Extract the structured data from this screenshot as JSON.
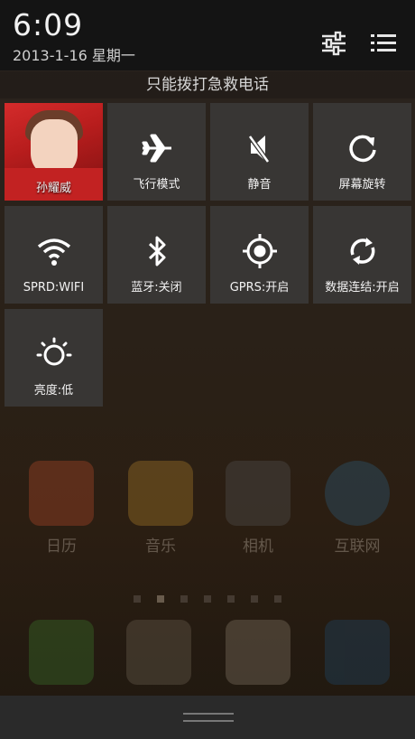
{
  "status": {
    "time": "6:09",
    "date": "2013-1-16 星期一"
  },
  "header_icons": {
    "settings": "sliders-icon",
    "list": "list-icon"
  },
  "notice": "只能拨打急救电话",
  "tiles": [
    {
      "label": "孙耀威",
      "icon": "avatar"
    },
    {
      "label": "飞行模式",
      "icon": "airplane-icon"
    },
    {
      "label": "静音",
      "icon": "mute-icon"
    },
    {
      "label": "屏幕旋转",
      "icon": "rotate-icon"
    },
    {
      "label": "SPRD:WIFI",
      "icon": "wifi-icon"
    },
    {
      "label": "蓝牙:关闭",
      "icon": "bluetooth-icon"
    },
    {
      "label": "GPRS:开启",
      "icon": "gps-icon"
    },
    {
      "label": "数据连结:开启",
      "icon": "sync-icon"
    },
    {
      "label": "亮度:低",
      "icon": "brightness-icon"
    }
  ],
  "home_apps": [
    {
      "label": "日历"
    },
    {
      "label": "音乐"
    },
    {
      "label": "相机"
    },
    {
      "label": "互联网"
    }
  ],
  "dock_apps": [
    {
      "icon": "phone-icon"
    },
    {
      "icon": "contacts-icon"
    },
    {
      "icon": "message-icon"
    },
    {
      "icon": "app-drawer-icon"
    }
  ],
  "page_indicator": {
    "pages": 7,
    "current": 2
  },
  "colors": {
    "tile": "#383634",
    "header": "#141414",
    "text": "#f3f3f3"
  }
}
